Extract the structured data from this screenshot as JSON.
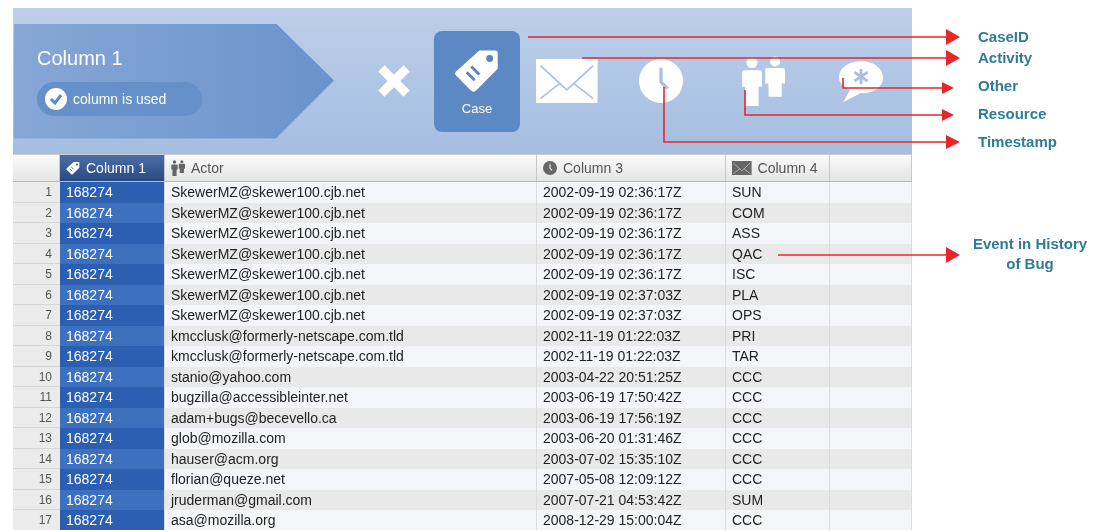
{
  "mapping_panel": {
    "column_title": "Column 1",
    "used_badge": {
      "label": "column is used",
      "checked": true
    },
    "type_buttons": [
      {
        "kind": "remove",
        "selected": false
      },
      {
        "kind": "caseid",
        "label": "Case",
        "selected": true
      },
      {
        "kind": "activity",
        "selected": false
      },
      {
        "kind": "timestamp",
        "selected": false
      },
      {
        "kind": "resource",
        "selected": false
      },
      {
        "kind": "other",
        "selected": false
      }
    ]
  },
  "table": {
    "columns": [
      {
        "label": "Column 1",
        "kind": "caseid",
        "selected": true
      },
      {
        "label": "Actor",
        "kind": "resource",
        "selected": false
      },
      {
        "label": "Column 3",
        "kind": "timestamp",
        "selected": false
      },
      {
        "label": "Column 4",
        "kind": "activity",
        "selected": false
      }
    ],
    "rows": [
      {
        "number": "1",
        "cells": [
          "168274",
          "SkewerMZ@skewer100.cjb.net",
          "2002-09-19 02:36:17Z",
          "SUN"
        ]
      },
      {
        "number": "2",
        "cells": [
          "168274",
          "SkewerMZ@skewer100.cjb.net",
          "2002-09-19 02:36:17Z",
          "COM"
        ]
      },
      {
        "number": "3",
        "cells": [
          "168274",
          "SkewerMZ@skewer100.cjb.net",
          "2002-09-19 02:36:17Z",
          "ASS"
        ]
      },
      {
        "number": "4",
        "cells": [
          "168274",
          "SkewerMZ@skewer100.cjb.net",
          "2002-09-19 02:36:17Z",
          "QAC"
        ]
      },
      {
        "number": "5",
        "cells": [
          "168274",
          "SkewerMZ@skewer100.cjb.net",
          "2002-09-19 02:36:17Z",
          "ISC"
        ]
      },
      {
        "number": "6",
        "cells": [
          "168274",
          "SkewerMZ@skewer100.cjb.net",
          "2002-09-19 02:37:03Z",
          "PLA"
        ]
      },
      {
        "number": "7",
        "cells": [
          "168274",
          "SkewerMZ@skewer100.cjb.net",
          "2002-09-19 02:37:03Z",
          "OPS"
        ]
      },
      {
        "number": "8",
        "cells": [
          "168274",
          "kmcclusk@formerly-netscape.com.tld",
          "2002-11-19 01:22:03Z",
          "PRI"
        ]
      },
      {
        "number": "9",
        "cells": [
          "168274",
          "kmcclusk@formerly-netscape.com.tld",
          "2002-11-19 01:22:03Z",
          "TAR"
        ]
      },
      {
        "number": "10",
        "cells": [
          "168274",
          "stanio@yahoo.com",
          "2003-04-22 20:51:25Z",
          "CCC"
        ]
      },
      {
        "number": "11",
        "cells": [
          "168274",
          "bugzilla@accessibleinter.net",
          "2003-06-19 17:50:42Z",
          "CCC"
        ]
      },
      {
        "number": "12",
        "cells": [
          "168274",
          "adam+bugs@becevello.ca",
          "2003-06-19 17:56:19Z",
          "CCC"
        ]
      },
      {
        "number": "13",
        "cells": [
          "168274",
          "glob@mozilla.com",
          "2003-06-20 01:31:46Z",
          "CCC"
        ]
      },
      {
        "number": "14",
        "cells": [
          "168274",
          "hauser@acm.org",
          "2003-07-02 15:35:10Z",
          "CCC"
        ]
      },
      {
        "number": "15",
        "cells": [
          "168274",
          "florian@queze.net",
          "2007-05-08 12:09:12Z",
          "CCC"
        ]
      },
      {
        "number": "16",
        "cells": [
          "168274",
          "jruderman@gmail.com",
          "2007-07-21 04:53:42Z",
          "SUM"
        ]
      },
      {
        "number": "17",
        "cells": [
          "168274",
          "asa@mozilla.org",
          "2008-12-29 15:00:04Z",
          "CCC"
        ]
      }
    ]
  },
  "annotations": [
    {
      "kind": "caseid",
      "label": "CaseID"
    },
    {
      "kind": "activity",
      "label": "Activity"
    },
    {
      "kind": "other",
      "label": "Other"
    },
    {
      "kind": "resource",
      "label": "Resource"
    },
    {
      "kind": "timestamp",
      "label": "Timestamp"
    },
    {
      "kind": "event",
      "label": "Event in History of Bug"
    }
  ]
}
